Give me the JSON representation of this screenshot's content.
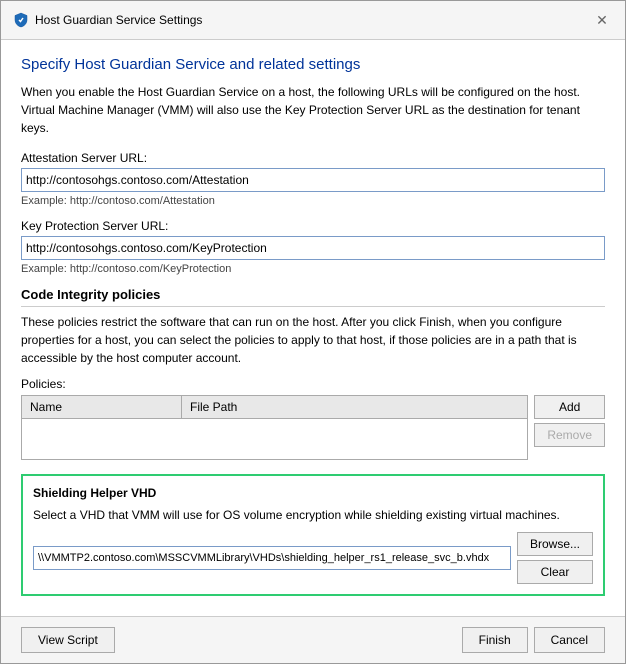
{
  "titleBar": {
    "icon": "shield",
    "title": "Host Guardian Service Settings",
    "closeLabel": "✕"
  },
  "pageTitle": "Specify Host Guardian Service and related settings",
  "description": "When you enable the Host Guardian Service on a host, the following URLs will be configured on the host. Virtual Machine Manager (VMM) will also use the Key Protection Server URL as the destination for tenant keys.",
  "attestationSection": {
    "label": "Attestation Server URL:",
    "value": "http://contosohgs.contoso.com/Attestation",
    "example": "Example: http://contoso.com/Attestation"
  },
  "keyProtectionSection": {
    "label": "Key Protection Server URL:",
    "value": "http://contosohgs.contoso.com/KeyProtection",
    "example": "Example: http://contoso.com/KeyProtection"
  },
  "codeIntegritySection": {
    "title": "Code Integrity policies",
    "description": "These policies restrict the software that can run on the host. After you click Finish, when you configure properties for a host, you can select the policies to apply to that host, if those policies are in a path that is accessible by the host computer account.",
    "policiesLabel": "Policies:",
    "tableHeaders": [
      "Name",
      "File Path"
    ],
    "addButton": "Add",
    "removeButton": "Remove"
  },
  "shieldingSection": {
    "title": "Shielding Helper VHD",
    "description": "Select a VHD that VMM will use for OS volume encryption while shielding existing virtual machines.",
    "vhdPath": "\\\\VMMTP2.contoso.com\\MSSCVMMLibrary\\VHDs\\shielding_helper_rs1_release_svc_b.vhdx",
    "browseButton": "Browse...",
    "clearButton": "Clear"
  },
  "footer": {
    "viewScriptButton": "View Script",
    "finishButton": "Finish",
    "cancelButton": "Cancel"
  }
}
